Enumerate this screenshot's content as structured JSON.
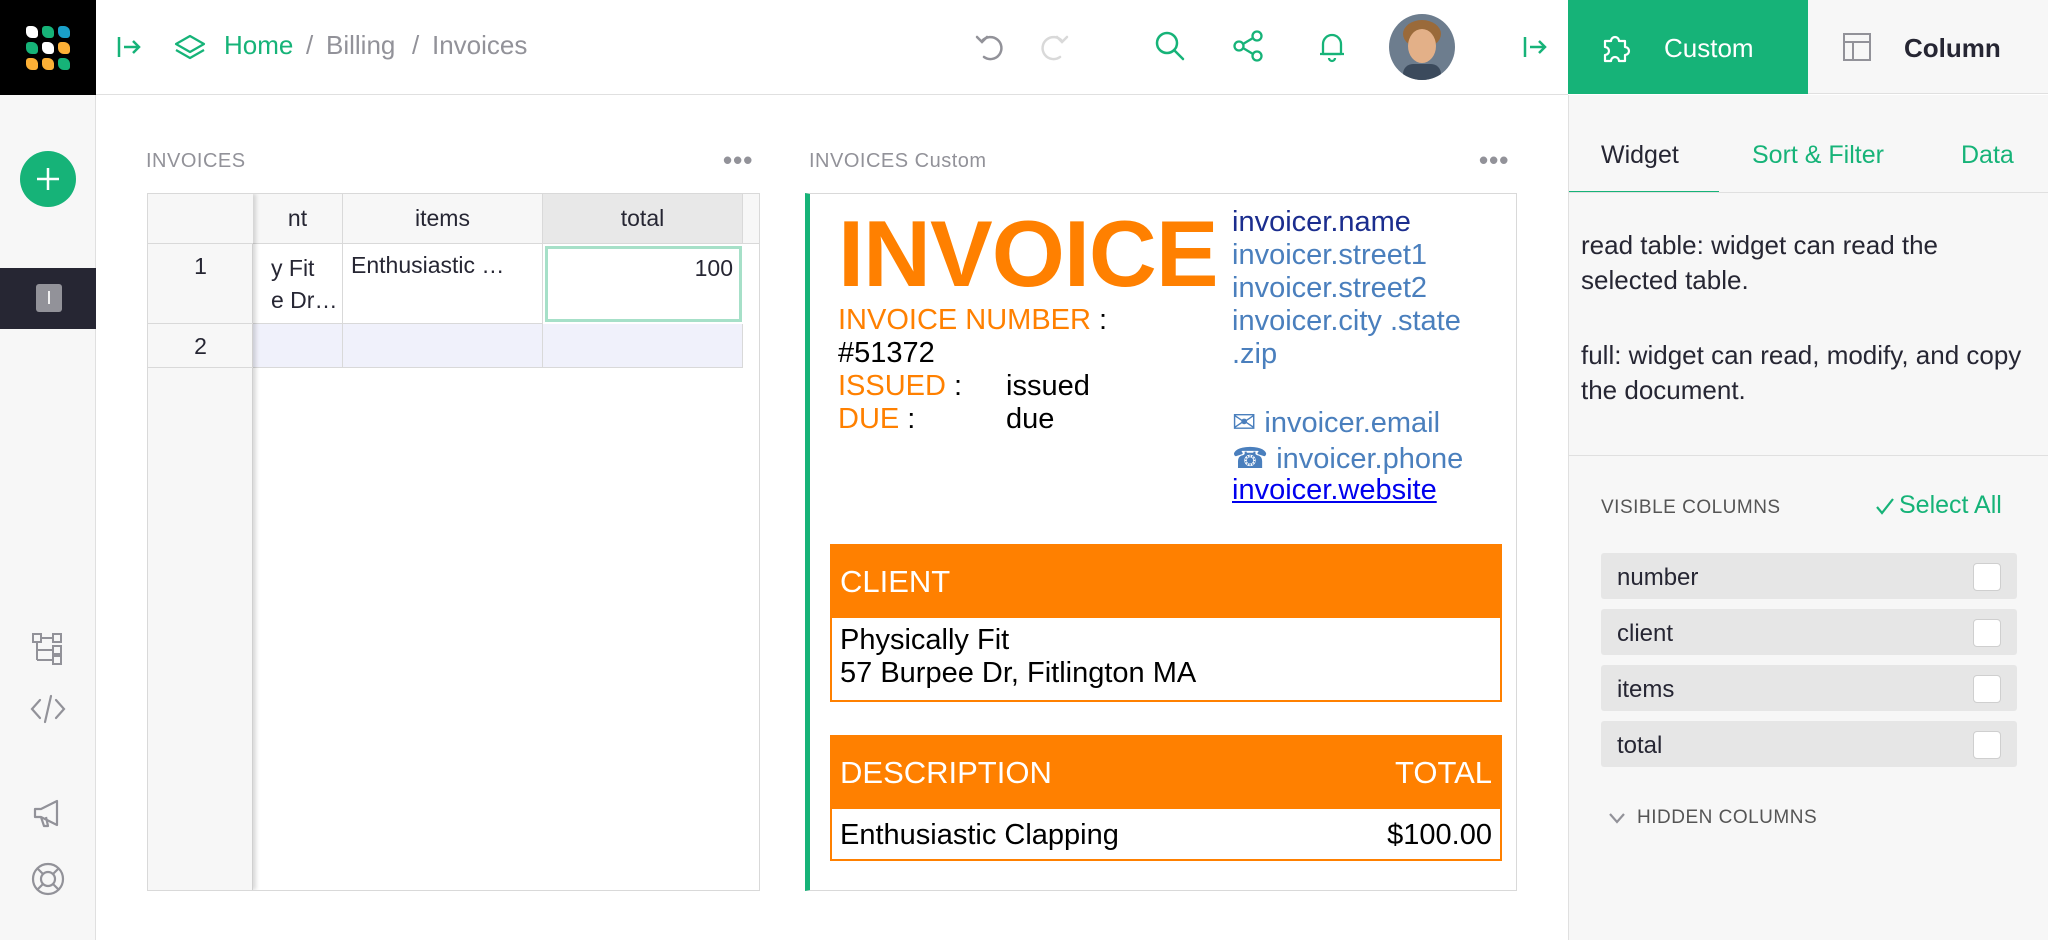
{
  "topbar": {
    "breadcrumb": {
      "home": "Home",
      "sep1": "/",
      "billing": "Billing",
      "sep2": "/",
      "invoices": "Invoices"
    },
    "right_tabs": {
      "custom": "Custom",
      "column": "Column"
    }
  },
  "left_sidebar": {
    "page_initial": "I"
  },
  "grid_section": {
    "title": "INVOICES",
    "more": "•••",
    "columns": [
      "nt",
      "items",
      "total"
    ],
    "rows": [
      {
        "num": "1",
        "client_line1": "y Fit",
        "client_line2": "e Dr…",
        "items": "Enthusiastic …",
        "total": "100"
      },
      {
        "num": "2"
      }
    ]
  },
  "custom_section": {
    "title": "INVOICES Custom",
    "more": "•••",
    "invoice": {
      "heading": "INVOICE",
      "number_label": "INVOICE NUMBER",
      "number_colon": ":",
      "number_value": "#51372",
      "issued_label": "ISSUED",
      "issued_colon": ":",
      "issued_value": "issued",
      "due_label": "DUE",
      "due_colon": ":",
      "due_value": "due",
      "invoicer_name": "invoicer.name",
      "invoicer_street1": "invoicer.street1",
      "invoicer_street2": "invoicer.street2",
      "invoicer_citystate": "invoicer.city .state",
      "invoicer_zip": ".zip",
      "email_icon": "✉",
      "invoicer_email": "invoicer.email",
      "phone_icon": "☎",
      "invoicer_phone": "invoicer.phone",
      "invoicer_website": "invoicer.website",
      "client_header": "CLIENT",
      "client_name": "Physically Fit",
      "client_address": "57 Burpee Dr, Fitlington MA",
      "desc_header": "DESCRIPTION",
      "total_header": "TOTAL",
      "line_desc": "Enthusiastic Clapping",
      "line_total": "$100.00"
    }
  },
  "right_panel": {
    "subtabs": {
      "widget": "Widget",
      "sort_filter": "Sort & Filter",
      "data": "Data"
    },
    "access_read": "read table: widget can read the selected table.",
    "access_full": "full: widget can read, modify, and copy the document.",
    "visible_columns_label": "VISIBLE COLUMNS",
    "select_all": "Select All",
    "visible_columns": [
      "number",
      "client",
      "items",
      "total"
    ],
    "hidden_columns_label": "HIDDEN COLUMNS"
  },
  "colors": {
    "accent": "#16b378",
    "invoice_orange": "#ff8000",
    "sidebar_dark": "#262633"
  },
  "icons": [
    "logo",
    "panel-collapse-icon",
    "pages-icon",
    "undo-icon",
    "redo-icon",
    "search-icon",
    "share-icon",
    "notification-icon",
    "user-avatar",
    "panel-expand-icon",
    "widget-puzzle-icon",
    "column-layout-icon",
    "plus-icon",
    "raw-data-icon",
    "code-view-icon",
    "announcement-icon",
    "help-icon",
    "checkmark-icon",
    "chevron-down-icon"
  ]
}
